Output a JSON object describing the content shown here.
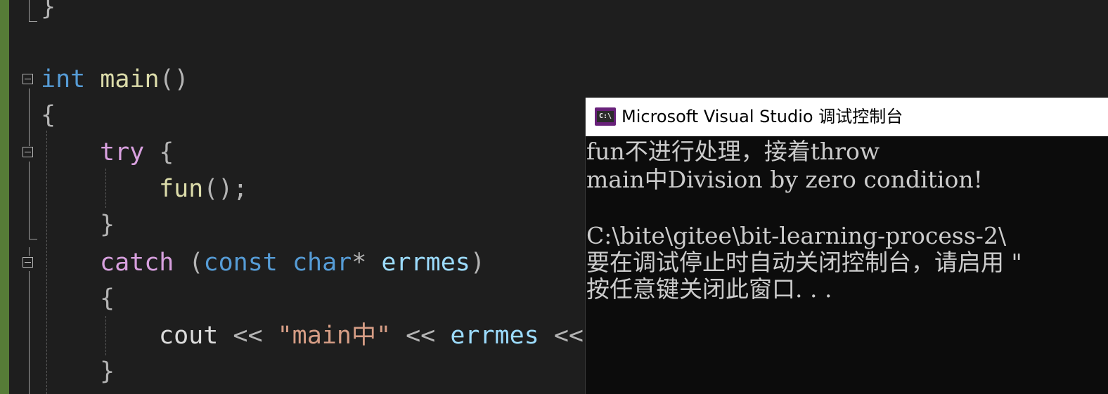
{
  "editor": {
    "lines": {
      "line1": {
        "brace": "}"
      },
      "line2": {
        "kw": "int",
        "fn": "main",
        "parens": "()"
      },
      "line3": {
        "brace": "{"
      },
      "line4": {
        "ctl": "try",
        "brace": "{"
      },
      "line5": {
        "fn": "fun",
        "rest": "();"
      },
      "line6": {
        "brace": "}"
      },
      "line7": {
        "ctl": "catch",
        "open": " (",
        "kw1": "const",
        "kw2": "char",
        "star": "*",
        "var": "errmes",
        "close": ")"
      },
      "line8": {
        "brace": "{"
      },
      "line9": {
        "ident": "cout",
        "op1": " << ",
        "str": "\"main中\"",
        "op2": " << ",
        "var": "errmes",
        "op3": " <<"
      },
      "line10": {
        "brace": "}"
      }
    },
    "icons": {
      "fold": "collapse-minus-icon"
    },
    "colors": {
      "keyword": "#569cd6",
      "control": "#d8a0df",
      "function": "#dcdcaa",
      "variable": "#9cdcfe",
      "string": "#d69d85",
      "change_bar": "#567c37"
    }
  },
  "console": {
    "title": "Microsoft Visual Studio 调试控制台",
    "icon": "vs-debug-console-icon",
    "icon_text": "C:\\",
    "lines": [
      "fun不进行处理，接着throw",
      "main中Division by zero condition!",
      "",
      "C:\\bite\\gitee\\bit-learning-process-2\\",
      "要在调试停止时自动关闭控制台，请启用 \"",
      "按任意键关闭此窗口. . ."
    ]
  }
}
